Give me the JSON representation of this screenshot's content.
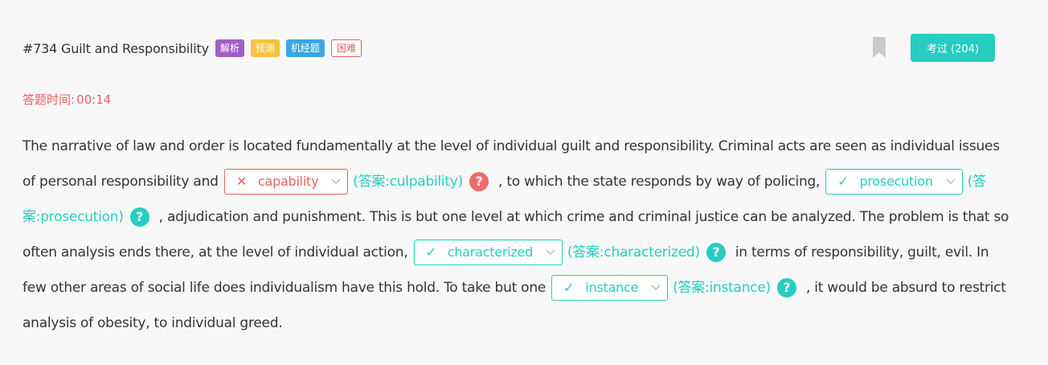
{
  "header": {
    "title": "#734 Guilt and Responsibility",
    "tags": [
      {
        "label": "解析",
        "color": "#a35ec4"
      },
      {
        "label": "预测",
        "color": "#f6c341"
      },
      {
        "label": "机经题",
        "color": "#3ba7e0"
      },
      {
        "label": "困难",
        "color": "#ea5d5d"
      }
    ],
    "passed_button": "考过 (204)"
  },
  "timer": {
    "label": "答题时间:",
    "value": "00:14"
  },
  "passage": {
    "segments": [
      "The narrative of law and order is located fundamentally at the level of individual guilt and responsibility. Criminal acts are seen as individual issues of personal responsibility and",
      ", to which the state responds by way of policing,",
      ", adjudication and punishment. This is but one level at which crime and criminal justice can be analyzed. The problem is that so often analysis ends there, at the level of individual action,",
      "in terms of responsibility, guilt, evil. In few other areas of social life does individualism have this hold. To take but one",
      ", it would be absurd to restrict analysis of obesity, to individual greed."
    ],
    "blanks": [
      {
        "selected": "capability",
        "status_mark": "✕",
        "answer": "(答案:culpability)",
        "help": "?"
      },
      {
        "selected": "prosecution",
        "status_mark": "✓",
        "answer": "(答案:prosecution)",
        "help": "?"
      },
      {
        "selected": "characterized",
        "status_mark": "✓",
        "answer": "(答案:characterized)",
        "help": "?"
      },
      {
        "selected": "instance",
        "status_mark": "✓",
        "answer": "(答案:instance)",
        "help": "?"
      }
    ]
  },
  "colors": {
    "accent": "#26cdc0",
    "error": "#ea6262",
    "background": "#f8f8f8"
  }
}
